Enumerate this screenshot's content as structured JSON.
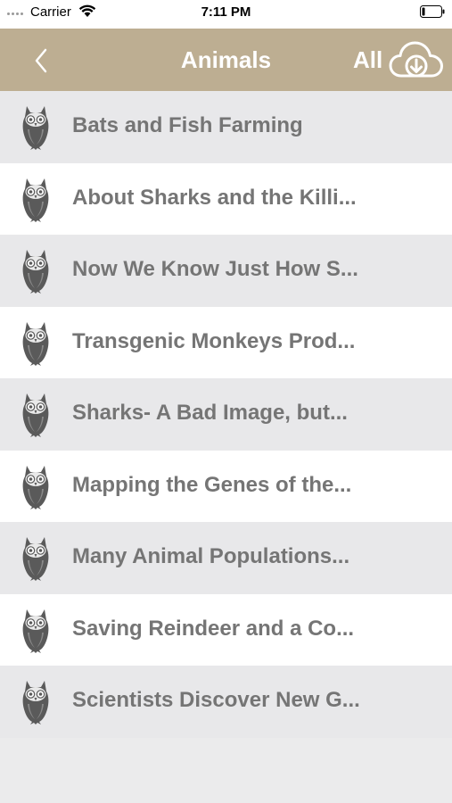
{
  "status_bar": {
    "carrier": "Carrier",
    "time": "7:11 PM",
    "wifi_icon": "wifi-icon",
    "battery_icon": "battery-icon"
  },
  "nav": {
    "title": "Animals",
    "all_label": "All",
    "back_icon": "chevron-left-icon",
    "download_icon": "cloud-download-icon",
    "background_color": "#bdae92"
  },
  "items": [
    {
      "label": "Bats and Fish Farming"
    },
    {
      "label": "About Sharks and the Killi..."
    },
    {
      "label": "Now We Know Just How S..."
    },
    {
      "label": "Transgenic Monkeys Prod..."
    },
    {
      "label": "Sharks- A Bad Image, but..."
    },
    {
      "label": "Mapping the Genes of the..."
    },
    {
      "label": "Many Animal Populations..."
    },
    {
      "label": "Saving Reindeer and a Co..."
    },
    {
      "label": "Scientists Discover New G..."
    }
  ],
  "colors": {
    "item_text": "#757575",
    "row_alt": "#e8e8ea",
    "row_white": "#ffffff",
    "owl_icon": "#5a5a5a"
  }
}
